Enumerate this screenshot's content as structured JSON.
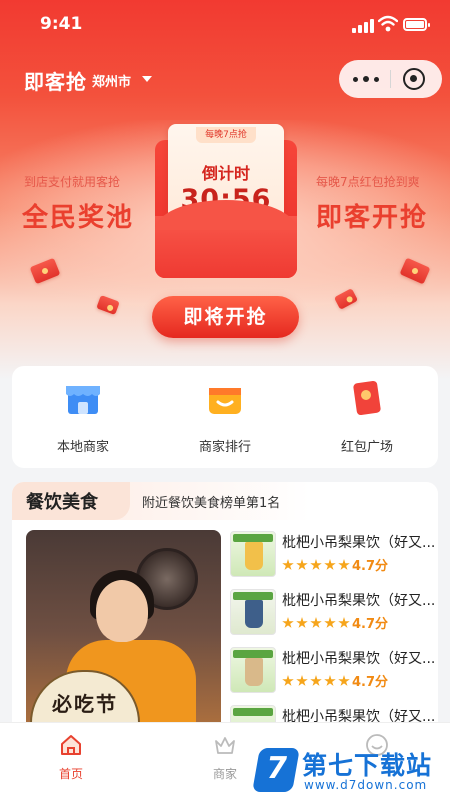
{
  "status_bar": {
    "time": "9:41"
  },
  "header": {
    "app_title": "即客抢",
    "city": "郑州市"
  },
  "promo": {
    "left_sub": "到店支付就用客抢",
    "left_title": "全民奖池",
    "right_sub": "每晚7点红包抢到爽",
    "right_title": "即客开抢",
    "envelope_tag": "每晚7点抢",
    "countdown_label": "倒计时",
    "countdown_value": "30:56",
    "start_button": "即将开抢"
  },
  "quick_nav": [
    {
      "label": "本地商家",
      "icon": "shop-icon"
    },
    {
      "label": "商家排行",
      "icon": "ranking-bag-icon"
    },
    {
      "label": "红包广场",
      "icon": "red-envelope-icon"
    }
  ],
  "food_section": {
    "title": "餐饮美食",
    "subtitle": "附近餐饮美食榜单第1名",
    "feature_fan_text": "必吃节",
    "items": [
      {
        "name": "枇杷小吊梨果饮（好又...",
        "rating": "4.7分",
        "stars": 5
      },
      {
        "name": "枇杷小吊梨果饮（好又...",
        "rating": "4.7分",
        "stars": 5
      },
      {
        "name": "枇杷小吊梨果饮（好又...",
        "rating": "4.7分",
        "stars": 5
      },
      {
        "name": "枇杷小吊梨果饮（好又...",
        "rating": "",
        "stars": 0
      }
    ]
  },
  "tab_bar": {
    "tabs": [
      {
        "label": "首页",
        "icon": "home-icon",
        "active": true
      },
      {
        "label": "商家",
        "icon": "crown-icon",
        "active": false
      },
      {
        "label": "",
        "icon": "profile-icon",
        "active": false
      }
    ]
  },
  "watermark": {
    "title": "第七下载站",
    "url": "www.d7down.com"
  },
  "colors": {
    "brand_red": "#ea3f2e",
    "rating_orange": "#f18a13",
    "tab_active": "#e8412f"
  }
}
